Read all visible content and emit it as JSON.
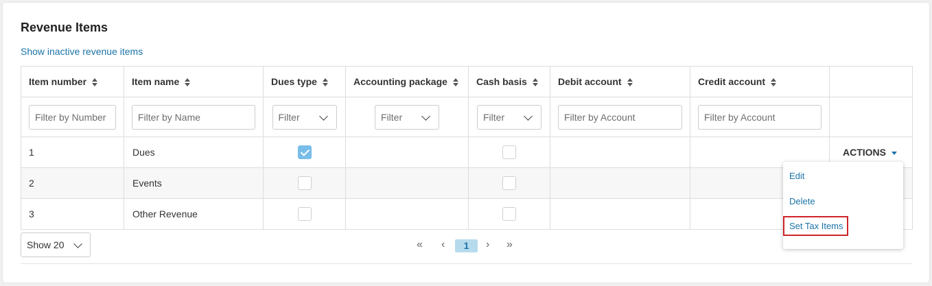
{
  "title": "Revenue Items",
  "show_inactive": "Show inactive revenue items",
  "columns": [
    "Item number",
    "Item name",
    "Dues type",
    "Accounting package",
    "Cash basis",
    "Debit account",
    "Credit account"
  ],
  "filters": {
    "number": "Filter by Number",
    "name": "Filter by Name",
    "dues_type": "Filter",
    "accounting": "Filter",
    "cash_basis": "Filter",
    "debit": "Filter by Account",
    "credit": "Filter by Account"
  },
  "rows": [
    {
      "number": "1",
      "name": "Dues",
      "dues_type": true,
      "cash_basis": false
    },
    {
      "number": "2",
      "name": "Events",
      "dues_type": false,
      "cash_basis": false
    },
    {
      "number": "3",
      "name": "Other Revenue",
      "dues_type": false,
      "cash_basis": false
    }
  ],
  "actions_label": "ACTIONS",
  "menu": [
    "Edit",
    "Delete",
    "Set Tax Items"
  ],
  "show_select": "Show 20",
  "pagination": {
    "first": "«",
    "prev": "‹",
    "page": "1",
    "next": "›",
    "last": "»"
  },
  "colors": {
    "link": "#1a73a8",
    "checked": "#79bde9",
    "highlight": "#d0232a"
  }
}
